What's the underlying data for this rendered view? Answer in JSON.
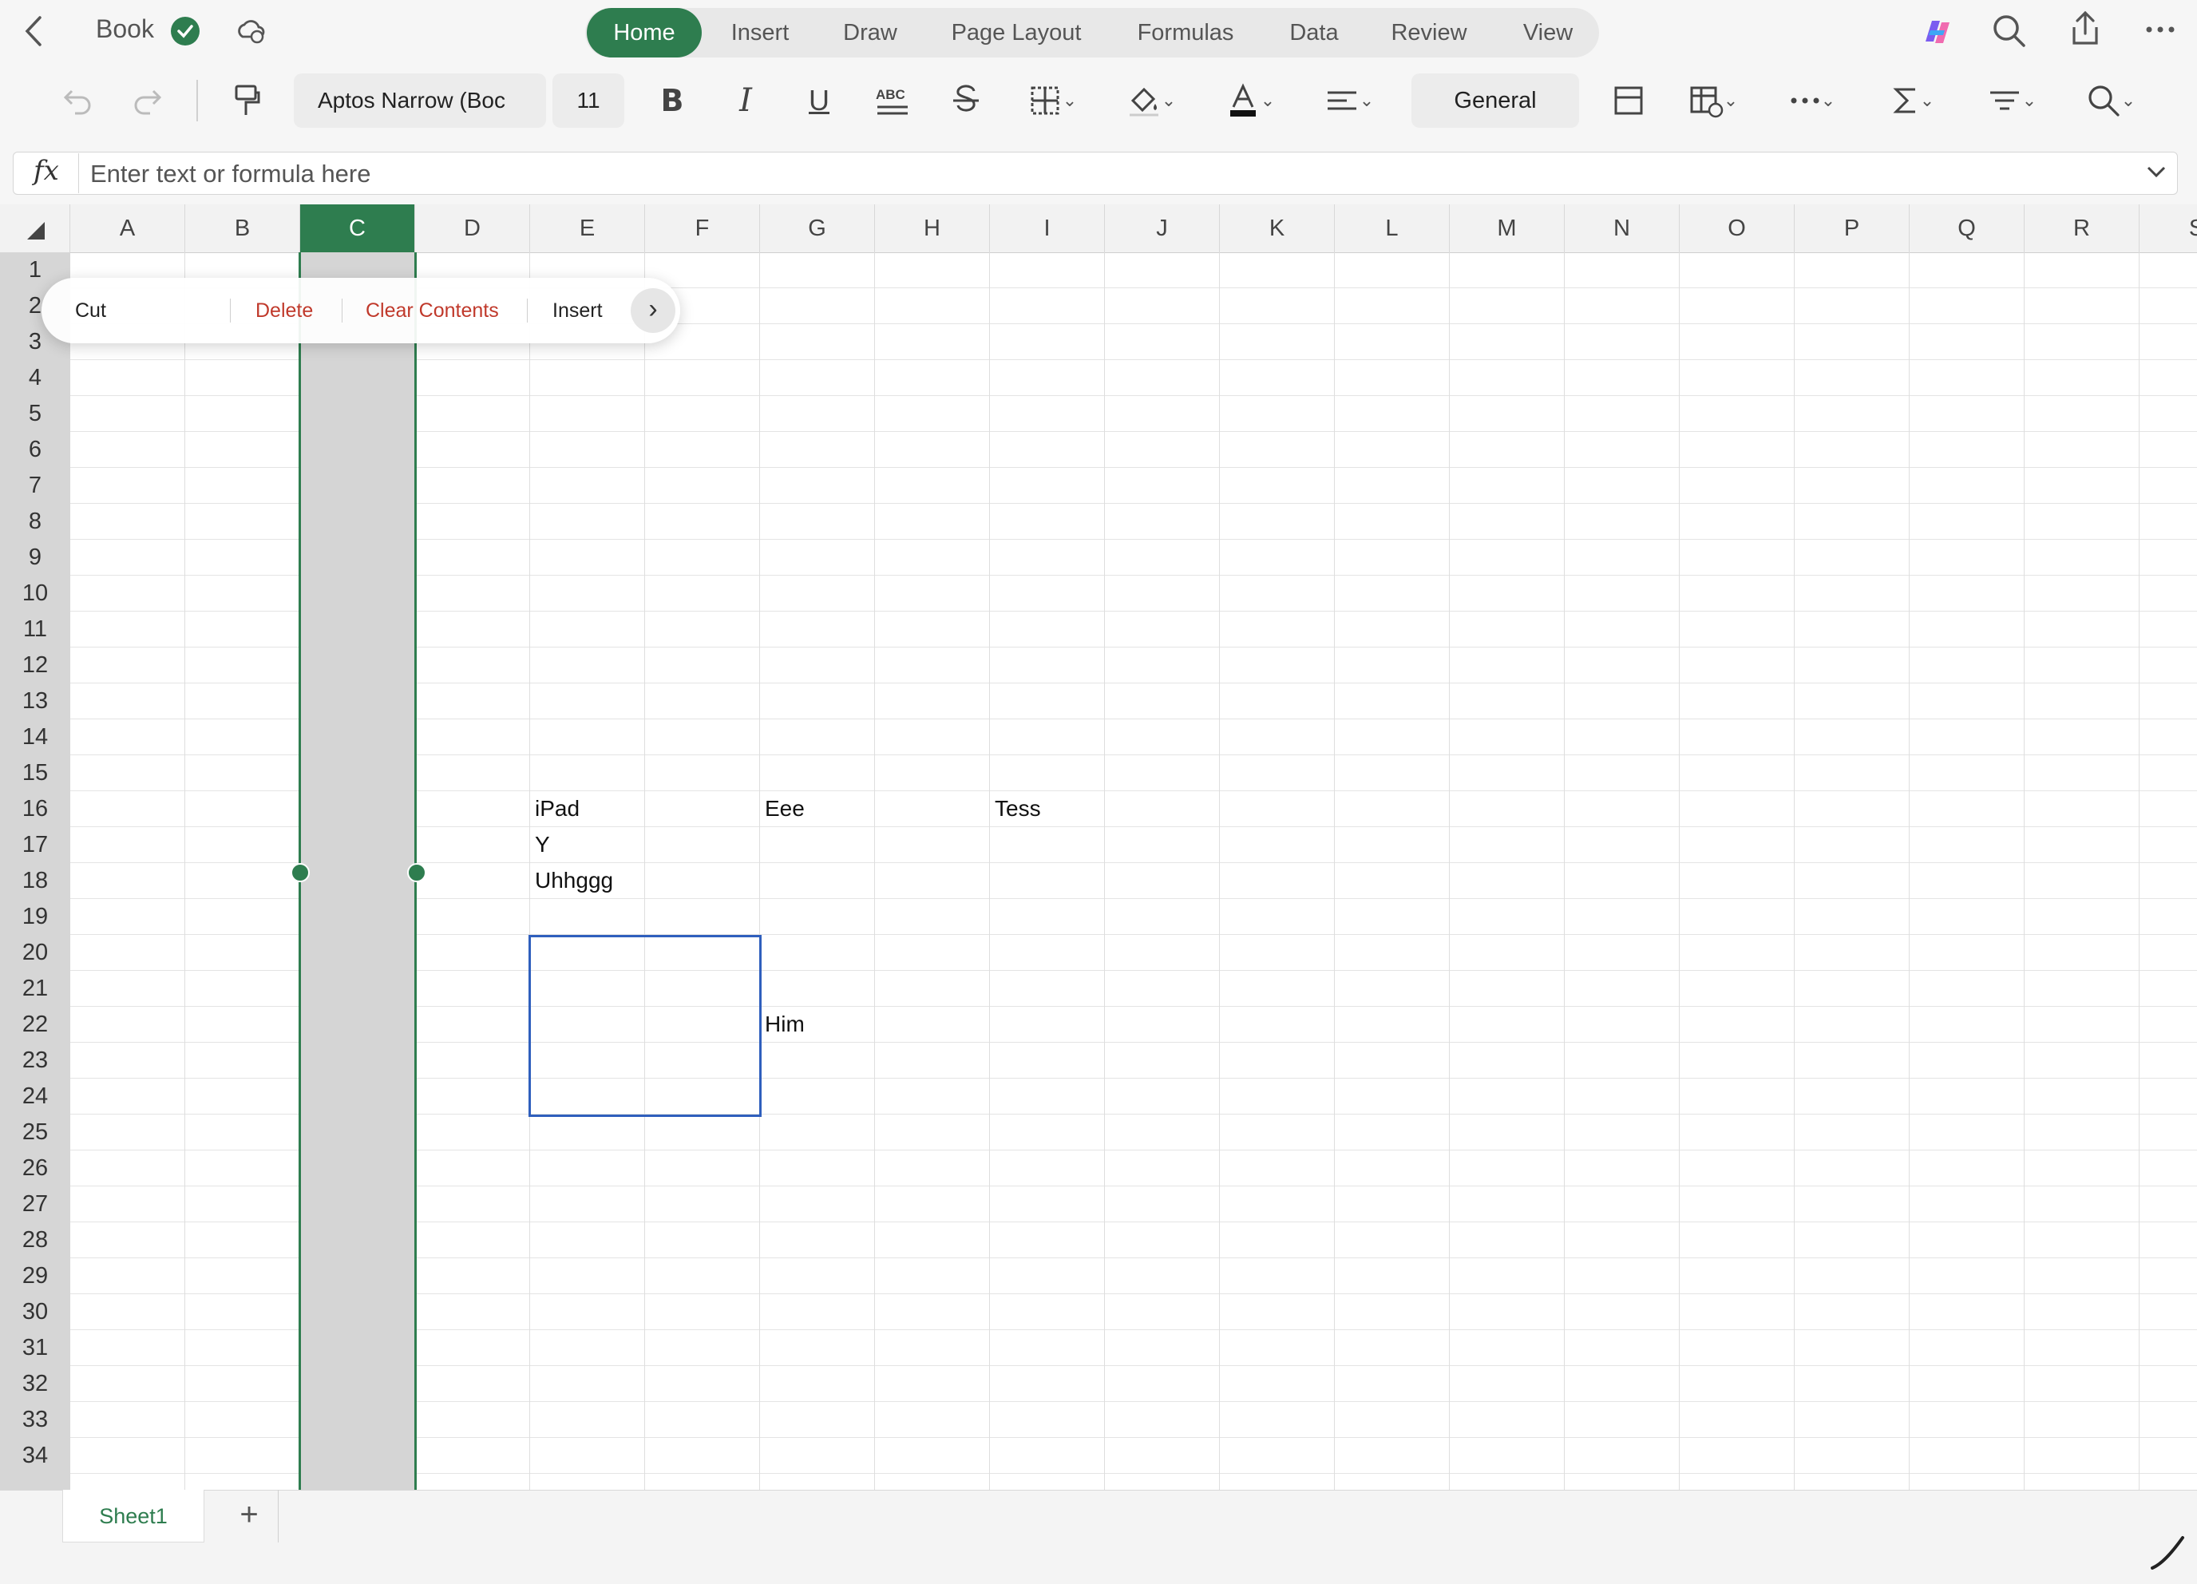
{
  "app": {
    "doc_title": "Book",
    "colors": {
      "accent": "#2e7d4f",
      "selection": "#2f5fbd",
      "danger": "#c0392b"
    }
  },
  "tabs": [
    {
      "label": "Home",
      "active": true
    },
    {
      "label": "Insert"
    },
    {
      "label": "Draw"
    },
    {
      "label": "Page Layout"
    },
    {
      "label": "Formulas"
    },
    {
      "label": "Data"
    },
    {
      "label": "Review"
    },
    {
      "label": "View"
    }
  ],
  "ribbon": {
    "font_name": "Aptos Narrow (Boc",
    "font_size": "11",
    "number_format": "General"
  },
  "formula_bar": {
    "label": "fx",
    "placeholder": "Enter text or formula here"
  },
  "columns": [
    "A",
    "B",
    "C",
    "D",
    "E",
    "F",
    "G",
    "H",
    "I",
    "J",
    "K",
    "L",
    "M",
    "N",
    "O",
    "P",
    "Q",
    "R",
    "S"
  ],
  "selected_column": "C",
  "rows": [
    "1",
    "2",
    "3",
    "4",
    "5",
    "6",
    "7",
    "8",
    "9",
    "10",
    "11",
    "12",
    "13",
    "14",
    "15",
    "16",
    "17",
    "18",
    "19",
    "20",
    "21",
    "22",
    "23",
    "24",
    "25",
    "26",
    "27",
    "28",
    "29",
    "30",
    "31",
    "32",
    "33",
    "34"
  ],
  "cells": [
    {
      "ref": "E16",
      "value": "iPad"
    },
    {
      "ref": "G16",
      "value": "Eee"
    },
    {
      "ref": "I16",
      "value": "Tess"
    },
    {
      "ref": "E17",
      "value": "Y"
    },
    {
      "ref": "E18",
      "value": "Uhhggg"
    },
    {
      "ref": "G22",
      "value": "Him"
    }
  ],
  "context_menu": {
    "cut": "Cut",
    "delete": "Delete",
    "clear_contents": "Clear Contents",
    "insert": "Insert",
    "more": "›"
  },
  "sheets": [
    {
      "label": "Sheet1",
      "active": true
    }
  ],
  "add_sheet": "+"
}
